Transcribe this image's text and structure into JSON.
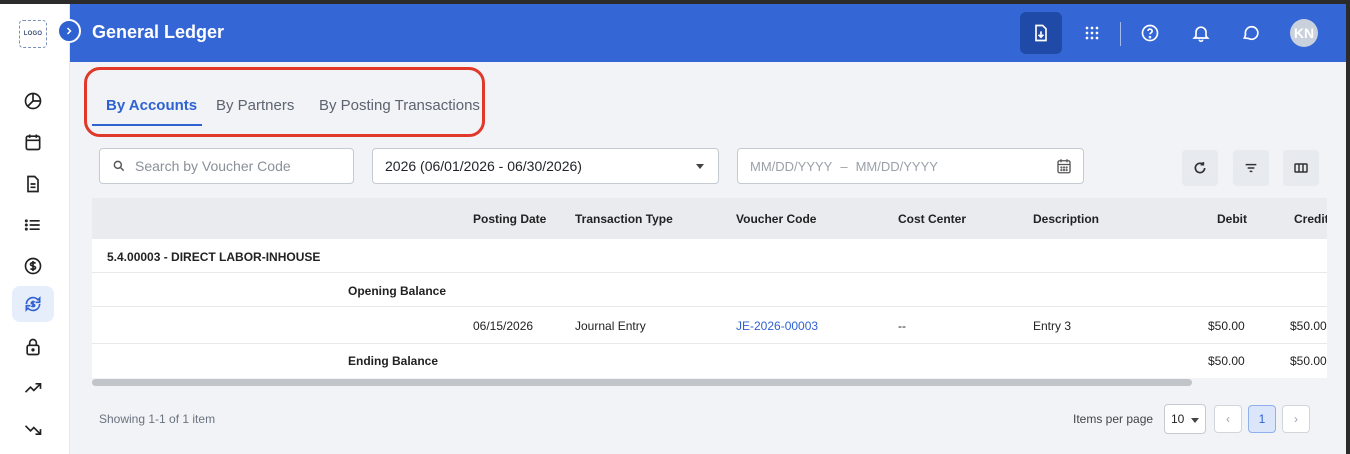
{
  "app": {
    "logo_text": "LOGO",
    "page_title": "General Ledger",
    "avatar_initials": "KN"
  },
  "header": {
    "icons": [
      "export-icon",
      "apps-grid-icon",
      "help-icon",
      "bell-icon",
      "chat-icon"
    ]
  },
  "sidebar": {
    "items": [
      {
        "icon": "pie-chart-icon",
        "active": false
      },
      {
        "icon": "calendar-icon",
        "active": false
      },
      {
        "icon": "document-icon",
        "active": false
      },
      {
        "icon": "list-icon",
        "active": false
      },
      {
        "icon": "dollar-icon",
        "active": false
      },
      {
        "icon": "currency-exchange-icon",
        "active": true
      },
      {
        "icon": "lock-icon",
        "active": false
      },
      {
        "icon": "trending-up-icon",
        "active": false
      },
      {
        "icon": "trending-down-icon",
        "active": false
      }
    ]
  },
  "tabs": [
    {
      "label": "By Accounts",
      "active": true
    },
    {
      "label": "By Partners",
      "active": false
    },
    {
      "label": "By Posting Transactions",
      "active": false
    }
  ],
  "filters": {
    "search_placeholder": "Search by Voucher Code",
    "period_value": "2026 (06/01/2026 - 06/30/2026)",
    "date_from_placeholder": "MM/DD/YYYY",
    "date_separator": "–",
    "date_to_placeholder": "MM/DD/YYYY"
  },
  "table": {
    "columns": [
      "",
      "",
      "Posting Date",
      "Transaction Type",
      "Voucher Code",
      "Cost Center",
      "Description",
      "Debit",
      "Credit"
    ],
    "account_row": "5.4.00003 - DIRECT LABOR-INHOUSE",
    "opening_label": "Opening Balance",
    "entry": {
      "posting_date": "06/15/2026",
      "transaction_type": "Journal Entry",
      "voucher_code": "JE-2026-00003",
      "cost_center": "--",
      "description": "Entry 3",
      "debit": "$50.00",
      "credit": "$50.00"
    },
    "ending": {
      "label": "Ending Balance",
      "debit": "$50.00",
      "credit": "$50.00"
    }
  },
  "footer": {
    "showing": "Showing 1-1 of 1 item",
    "items_per_page_label": "Items per page",
    "items_per_page_value": "10",
    "current_page": "1",
    "prev": "‹",
    "next": "›"
  },
  "colors": {
    "header_bg": "#3466d6",
    "accent": "#2f62d1",
    "highlight_border": "#e0392b"
  }
}
